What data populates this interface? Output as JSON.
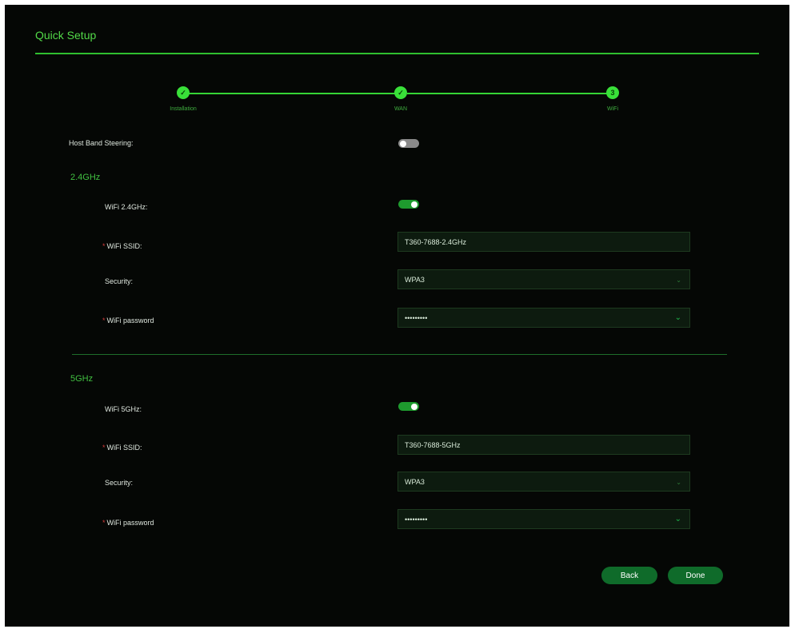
{
  "header": {
    "title": "Quick Setup"
  },
  "stepper": {
    "steps": [
      {
        "label": "Installation",
        "mark": "✓"
      },
      {
        "label": "WAN",
        "mark": "✓"
      },
      {
        "label": "WiFi",
        "mark": "3"
      }
    ]
  },
  "band_steering": {
    "label": "Host Band Steering:",
    "enabled": false
  },
  "band_24": {
    "heading": "2.4GHz",
    "wifi_label": "WiFi 2.4GHz:",
    "wifi_enabled": true,
    "ssid_label": "WiFi SSID:",
    "ssid_value": "T360-7688-2.4GHz",
    "security_label": "Security:",
    "security_value": "WPA3",
    "password_label": "WiFi password",
    "password_value": "•••••••••"
  },
  "band_5": {
    "heading": "5GHz",
    "wifi_label": "WiFi 5GHz:",
    "wifi_enabled": true,
    "ssid_label": "WiFi SSID:",
    "ssid_value": "T360-7688-5GHz",
    "security_label": "Security:",
    "security_value": "WPA3",
    "password_label": "WiFi password",
    "password_value": "•••••••••"
  },
  "required_marker": "*",
  "icons": {
    "select_arrow": "chevron-down-icon",
    "password_reveal": "chevron-down-icon"
  },
  "actions": {
    "back_label": "Back",
    "done_label": "Done"
  },
  "colors": {
    "accent": "#39e039",
    "background": "#050705",
    "button": "#0f6b2a",
    "required": "#d43b3b"
  }
}
